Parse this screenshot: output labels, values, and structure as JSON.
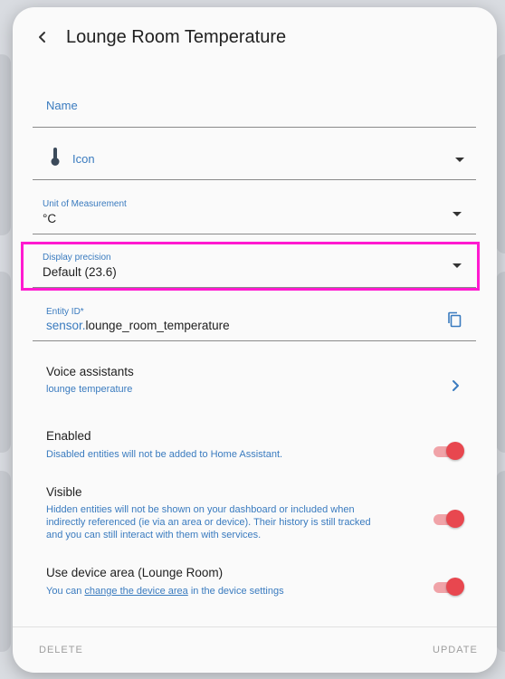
{
  "dialog": {
    "title": "Lounge Room Temperature",
    "fields": {
      "name_label": "Name",
      "icon_label": "Icon",
      "unit_label": "Unit of Measurement",
      "unit_value": "°C",
      "precision_label": "Display precision",
      "precision_value": "Default (23.6)",
      "entity_label": "Entity ID*",
      "entity_prefix": "sensor.",
      "entity_value": "lounge_room_temperature"
    },
    "voice": {
      "title": "Voice assistants",
      "subtitle": "lounge temperature"
    },
    "enabled": {
      "title": "Enabled",
      "subtitle": "Disabled entities will not be added to Home Assistant.",
      "on": true
    },
    "visible": {
      "title": "Visible",
      "subtitle_line1": "Hidden entities will not be shown on your dashboard or included when",
      "subtitle_line2": "indirectly referenced (ie via an area or device). Their history is still tracked",
      "subtitle_line3": "and you can still interact with them with services.",
      "on": true
    },
    "device_area": {
      "title": "Use device area (Lounge Room)",
      "subtitle_prefix": "You can ",
      "subtitle_link": "change the device area",
      "subtitle_suffix": " in the device settings",
      "on": true
    },
    "footer": {
      "delete_label": "DELETE",
      "update_label": "UPDATE"
    }
  },
  "colors": {
    "accent_blue": "#3a7bbf",
    "toggle_on": "#e8474f",
    "highlight": "#ff1ad0"
  },
  "icons": {
    "back": "chevron-left-icon",
    "thermometer": "thermometer-icon",
    "dropdown": "caret-down-icon",
    "copy": "copy-icon",
    "forward": "chevron-right-icon"
  }
}
